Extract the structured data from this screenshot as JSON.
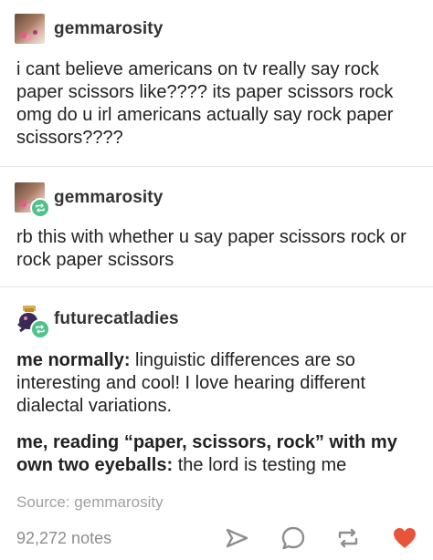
{
  "posts": [
    {
      "username": "gemmarosity",
      "text": "i cant believe americans on tv really say rock paper scissors like???? its paper scissors rock omg do u irl americans actually say rock paper scissors????"
    },
    {
      "username": "gemmarosity",
      "text": "rb this with whether u say paper scissors rock or rock paper scissors"
    },
    {
      "username": "futurecatladies",
      "para1_bold": "me normally:",
      "para1_text": " linguistic differences are so interesting and cool! I love hearing different dialectal variations.",
      "para2_bold": "me, reading “paper, scissors, rock” with my own two eyeballs:",
      "para2_text": " the lord is testing me"
    }
  ],
  "source": "Source: gemmarosity",
  "notes": "92,272 notes",
  "icons": {
    "share": "share-icon",
    "reply": "reply-icon",
    "reblog": "reblog-icon",
    "like": "heart-icon"
  },
  "colors": {
    "reblog_badge": "#4fc28a",
    "heart": "#e8533a",
    "icon_gray": "#8e8e8e"
  }
}
